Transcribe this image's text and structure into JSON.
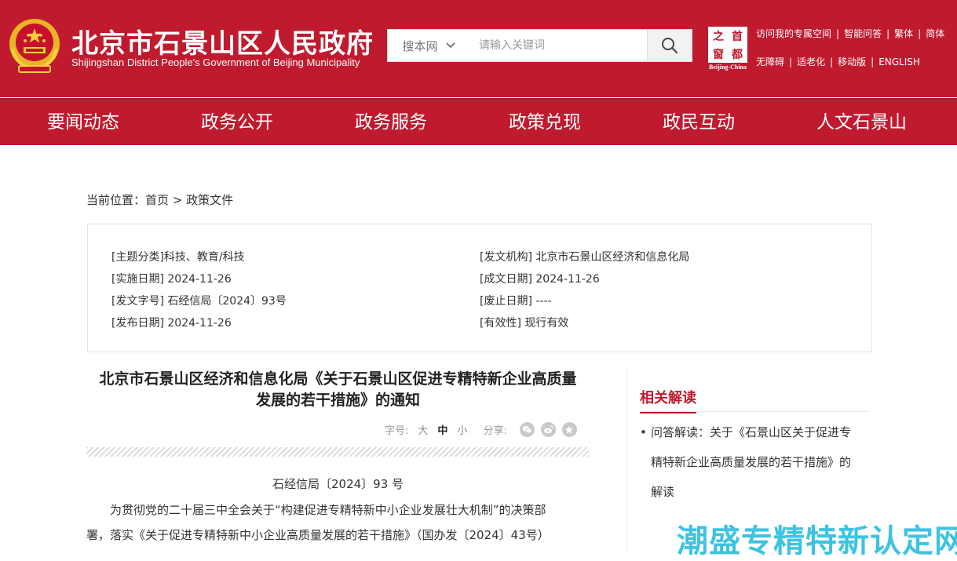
{
  "header": {
    "title": "北京市石景山区人民政府",
    "subtitle": "Shijingshan District People's Government of Beijing Municipality",
    "search": {
      "scope": "搜本网",
      "placeholder": "请输入关键词"
    },
    "capital_logo": {
      "chars": [
        "之",
        "首",
        "窗",
        "都"
      ],
      "caption": "Beijing-China"
    },
    "links_row1": [
      "访问我的专属空间",
      "智能问答",
      "繁体",
      "简体"
    ],
    "links_row2": [
      "无障碍",
      "适老化",
      "移动版",
      "ENGLISH"
    ],
    "colors": {
      "brand_red": "#c01a2e"
    }
  },
  "nav": [
    "要闻动态",
    "政务公开",
    "政务服务",
    "政策兑现",
    "政民互动",
    "人文石景山"
  ],
  "breadcrumb": {
    "label": "当前位置：",
    "home": "首页",
    "sep": " > ",
    "current": "政策文件"
  },
  "meta": {
    "topic": "[主题分类]科技、教育/科技",
    "issuer": "[发文机构] 北京市石景山区经济和信息化局",
    "effective": "[实施日期] 2024-11-26",
    "written": "[成文日期] 2024-11-26",
    "docno": "[发文字号] 石经信局〔2024〕93号",
    "repeal": "[废止日期] ----",
    "published": "[发布日期] 2024-11-26",
    "validity": "[有效性] 现行有效"
  },
  "article": {
    "title_line1": "北京市石景山区经济和信息化局《关于石景山区促进专精特新企业高质量",
    "title_line2": "发展的若干措施》的通知",
    "font_label": "字号:",
    "sizes": [
      "大",
      "中",
      "小"
    ],
    "active_size": "中",
    "share_label": "分享:",
    "share_icons": [
      "wechat-icon",
      "weibo-icon",
      "star-icon"
    ],
    "docnum": "石经信局〔2024〕93 号",
    "para1": "　　为贯彻党的二十届三中全会关于“构建促进专精特新中小企业发展壮大机制”的决策部",
    "para2": "署，落实《关于促进专精特新中小企业高质量发展的若干措施》（国办发〔2024〕43号）"
  },
  "related": {
    "title": "相关解读",
    "items": [
      "问答解读：关于《石景山区关于促进专精特新企业高质量发展的若干措施》的解读"
    ],
    "item_lines": [
      "问答解读：关于《石景山区关于促进专",
      "精特新企业高质量发展的若干措施》的",
      "解读"
    ]
  },
  "watermark": "潮盛专精特新认定网"
}
